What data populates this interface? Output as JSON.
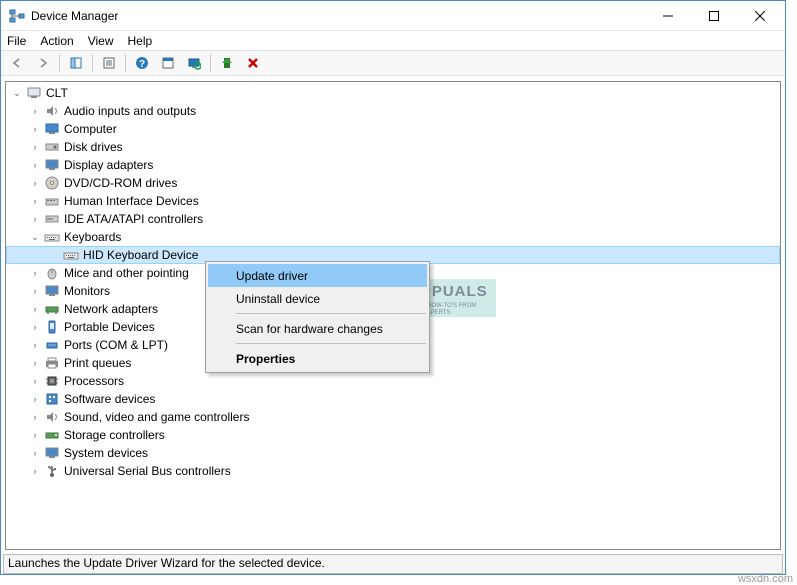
{
  "titlebar": {
    "title": "Device Manager"
  },
  "menubar": {
    "file": "File",
    "action": "Action",
    "view": "View",
    "help": "Help"
  },
  "tree": {
    "root": "CLT",
    "items": [
      "Audio inputs and outputs",
      "Computer",
      "Disk drives",
      "Display adapters",
      "DVD/CD-ROM drives",
      "Human Interface Devices",
      "IDE ATA/ATAPI controllers",
      "Keyboards",
      "HID Keyboard Device",
      "Mice and other pointing",
      "Monitors",
      "Network adapters",
      "Portable Devices",
      "Ports (COM & LPT)",
      "Print queues",
      "Processors",
      "Software devices",
      "Sound, video and game controllers",
      "Storage controllers",
      "System devices",
      "Universal Serial Bus controllers"
    ]
  },
  "context_menu": {
    "update": "Update driver",
    "uninstall": "Uninstall device",
    "scan": "Scan for hardware changes",
    "properties": "Properties"
  },
  "statusbar": {
    "text": "Launches the Update Driver Wizard for the selected device."
  },
  "watermark": {
    "brand": "APPUALS",
    "tagline1": "TECH HOW-TO'S FROM",
    "tagline2": "THE EXPERTS"
  },
  "attribution": "wsxdn.com"
}
